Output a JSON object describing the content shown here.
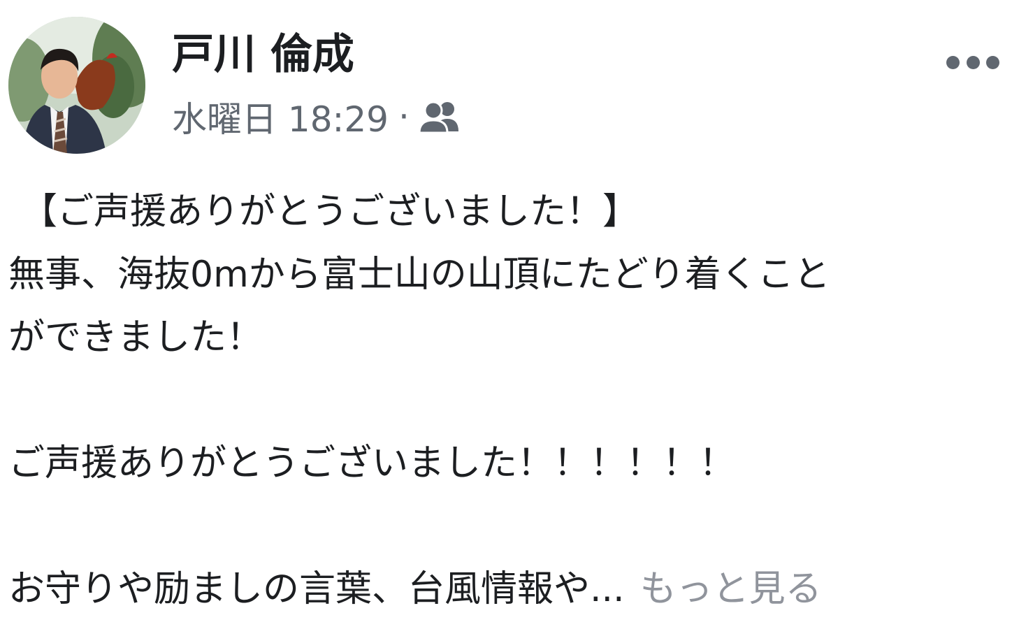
{
  "post": {
    "author": "戸川 倫成",
    "timestamp": "水曜日 18:29",
    "separator": "·",
    "audience_icon": "friends-icon",
    "more_icon": "more-options-icon",
    "lines": [
      "【ご声援ありがとうございました！】",
      "無事、海抜0mから富士山の山頂にたどり着くこと",
      "ができました！",
      "",
      "ご声援ありがとうございました！！！！！！",
      ""
    ],
    "truncated_line": "お守りや励ましの言葉、台風情報や...",
    "see_more": "もっと見る"
  },
  "colors": {
    "text": "#1c1e21",
    "secondary": "#606770",
    "see_more": "#90949c",
    "background": "#ffffff"
  }
}
